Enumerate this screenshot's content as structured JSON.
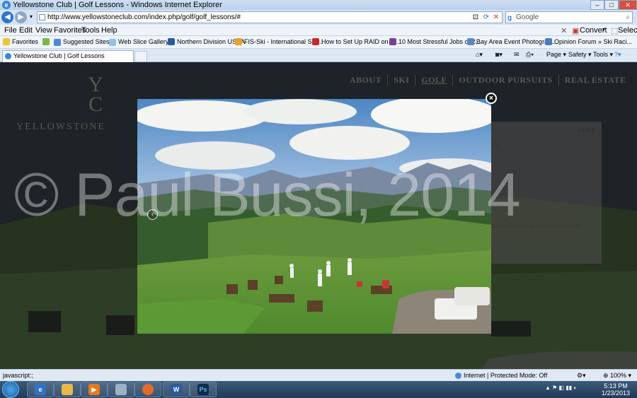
{
  "window": {
    "title": "Yellowstone Club | Golf Lessons - Windows Internet Explorer",
    "buttons": [
      "–",
      "□",
      "✕"
    ]
  },
  "address": {
    "url": "http://www.yellowstoneclub.com/index.php/golf/golf_lessons/#",
    "search_placeholder": "Google"
  },
  "menu": {
    "items": [
      "File",
      "Edit",
      "View",
      "Favorites",
      "Tools",
      "Help"
    ],
    "convert": "Convert",
    "select": "Select"
  },
  "favorites": {
    "label": "Favorites",
    "items": [
      "Suggested Sites ▾",
      "Web Slice Gallery ▾",
      "Northern Division USSA",
      "FIS-Ski - International Ski ...",
      "How to Set Up RAID on Y...",
      "10 Most Stressful Jobs of 2...",
      "Bay Area Event Photograp...",
      "Opinion Forum » Ski Raci..."
    ]
  },
  "tabs": {
    "active": "Yellowstone Club | Golf Lessons"
  },
  "commandbar": {
    "page": "Page ▾",
    "safety": "Safety ▾",
    "tools": "Tools ▾",
    "help": "?▾"
  },
  "site": {
    "nav": [
      "ABOUT",
      "SKI",
      "GOLF",
      "OUTDOOR PURSUITS",
      "REAL ESTATE"
    ],
    "logo_text": "YELLOWSTONE",
    "panel_hide": "« HIDE",
    "panel_text": "one-on-one and small group instruction.",
    "panel_heading": "ns"
  },
  "watermark": "© Paul Bussi, 2014",
  "status": {
    "left": "javascript:;",
    "zone": "Internet | Protected Mode: Off",
    "zoom": "⊕ 100% ▾"
  },
  "clock": {
    "time": "5:13 PM",
    "date": "1/23/2013"
  },
  "taskbar": [
    "Internet Explorer",
    "Windows Explorer",
    "Media Player",
    "Calculator",
    "Firefox",
    "Word",
    "Photoshop"
  ],
  "colors": {
    "accent": "#3b86d6",
    "overlay": "#1a1f22"
  }
}
